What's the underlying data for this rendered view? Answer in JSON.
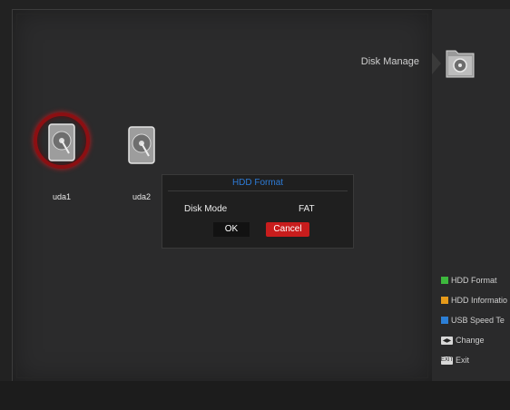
{
  "header": {
    "title": "Disk Manage",
    "icon": "folder-icon"
  },
  "disks": [
    {
      "label": "uda1",
      "selected": true,
      "icon": "hard-disk-icon"
    },
    {
      "label": "uda2",
      "selected": false,
      "icon": "hard-disk-icon"
    }
  ],
  "dialog": {
    "title": "HDD Format",
    "field_label": "Disk Mode",
    "field_value": "FAT",
    "ok_label": "OK",
    "cancel_label": "Cancel"
  },
  "legend": [
    {
      "label": "HDD Format",
      "color": "#3db83d",
      "icon": "green-key-icon"
    },
    {
      "label": "HDD Informatio",
      "color": "#e69a1a",
      "icon": "yellow-key-icon"
    },
    {
      "label": "USB Speed Te",
      "color": "#2c7fd6",
      "icon": "blue-key-icon"
    },
    {
      "label": "Change",
      "icon": "arrows-key-icon"
    },
    {
      "label": "Exit",
      "icon": "exit-key-icon"
    }
  ],
  "colors": {
    "accent_red": "#c81d1d",
    "dialog_title": "#2d7bd6"
  }
}
